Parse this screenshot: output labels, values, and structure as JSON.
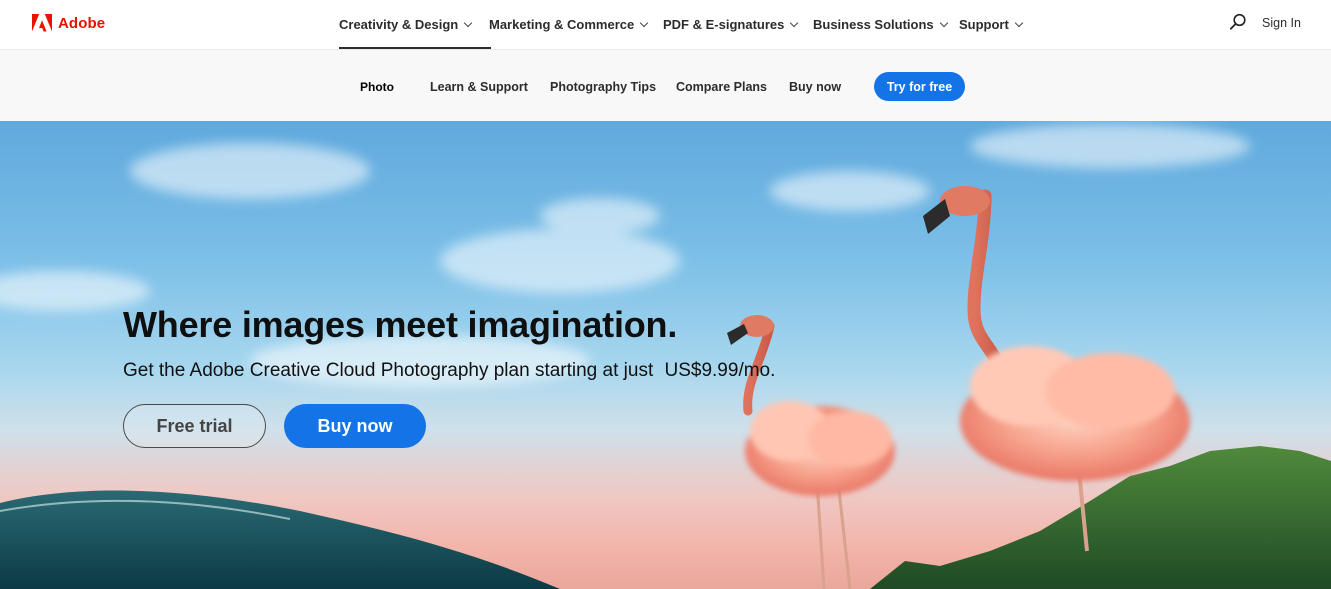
{
  "brand": {
    "name": "Adobe",
    "color": "#eb1000",
    "logo_icon": "adobe-logo-icon"
  },
  "global_nav": {
    "items": [
      {
        "label": "Creativity & Design",
        "active": true
      },
      {
        "label": "Marketing & Commerce",
        "active": false
      },
      {
        "label": "PDF & E-signatures",
        "active": false
      },
      {
        "label": "Business Solutions",
        "active": false
      },
      {
        "label": "Support",
        "active": false
      }
    ],
    "search_icon": "search-icon",
    "sign_in": "Sign In"
  },
  "local_nav": {
    "current": "Photo",
    "items": [
      {
        "label": "Learn & Support"
      },
      {
        "label": "Photography Tips"
      },
      {
        "label": "Compare Plans"
      },
      {
        "label": "Buy now"
      }
    ],
    "cta": "Try for free",
    "cta_color": "#1473e6"
  },
  "hero": {
    "title": "Where images meet imagination.",
    "subtitle": "Get the Adobe Creative Cloud Photography plan starting at just",
    "price": "US$9.99/mo.",
    "buttons": {
      "secondary": "Free trial",
      "primary": "Buy now"
    },
    "image_subject": "flamingos-with-cloud-bodies"
  }
}
